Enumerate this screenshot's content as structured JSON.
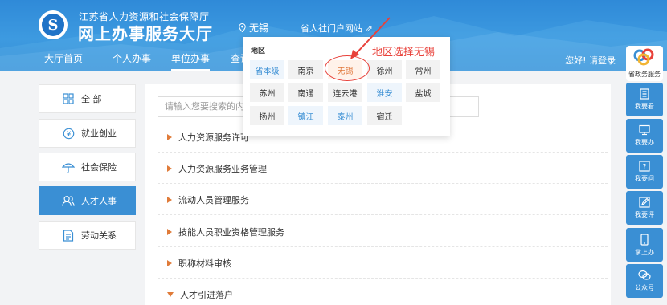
{
  "header": {
    "org_name": "江苏省人力资源和社会保障厅",
    "hall_name": "网上办事服务大厅",
    "region": "无锡",
    "portal_link": "省人社门户网站 ⇗",
    "greeting": "您好! 请登录"
  },
  "nav": {
    "items": [
      {
        "label": "大厅首页"
      },
      {
        "label": "个人办事"
      },
      {
        "label": "单位办事"
      },
      {
        "label": "查询"
      }
    ]
  },
  "sidebar": {
    "items": [
      {
        "label": "全 部",
        "icon": "grid-icon"
      },
      {
        "label": "就业创业",
        "icon": "coin-icon"
      },
      {
        "label": "社会保险",
        "icon": "umbrella-icon"
      },
      {
        "label": "人才人事",
        "icon": "users-icon"
      },
      {
        "label": "劳动关系",
        "icon": "document-icon"
      }
    ]
  },
  "search": {
    "placeholder": "请输入您要搜索的内容"
  },
  "list": {
    "items": [
      {
        "label": "人力资源服务许可"
      },
      {
        "label": "人力资源服务业务管理"
      },
      {
        "label": "流动人员管理服务"
      },
      {
        "label": "技能人员职业资格管理服务"
      },
      {
        "label": "职称材料审核"
      },
      {
        "label": "人才引进落户"
      }
    ]
  },
  "region_popup": {
    "title": "地区",
    "rows": [
      [
        "省本级",
        "南京",
        "无锡",
        "徐州",
        "常州"
      ],
      [
        "苏州",
        "南通",
        "连云港",
        "淮安",
        "盐城"
      ],
      [
        "扬州",
        "镇江",
        "泰州",
        "宿迁"
      ]
    ]
  },
  "annotation": {
    "text": "地区选择无锡"
  },
  "rail": {
    "top_label": "省政务服务",
    "buttons": [
      {
        "label": "我要看",
        "icon": "book-icon"
      },
      {
        "label": "我要办",
        "icon": "monitor-icon"
      },
      {
        "label": "我要问",
        "icon": "question-icon"
      },
      {
        "label": "我要评",
        "icon": "edit-icon"
      },
      {
        "label": "掌上办",
        "icon": "phone-icon"
      },
      {
        "label": "公众号",
        "icon": "wechat-icon"
      }
    ]
  },
  "colors": {
    "primary": "#3a8fd4",
    "accent": "#e07b39",
    "annotation": "#e8413a"
  }
}
